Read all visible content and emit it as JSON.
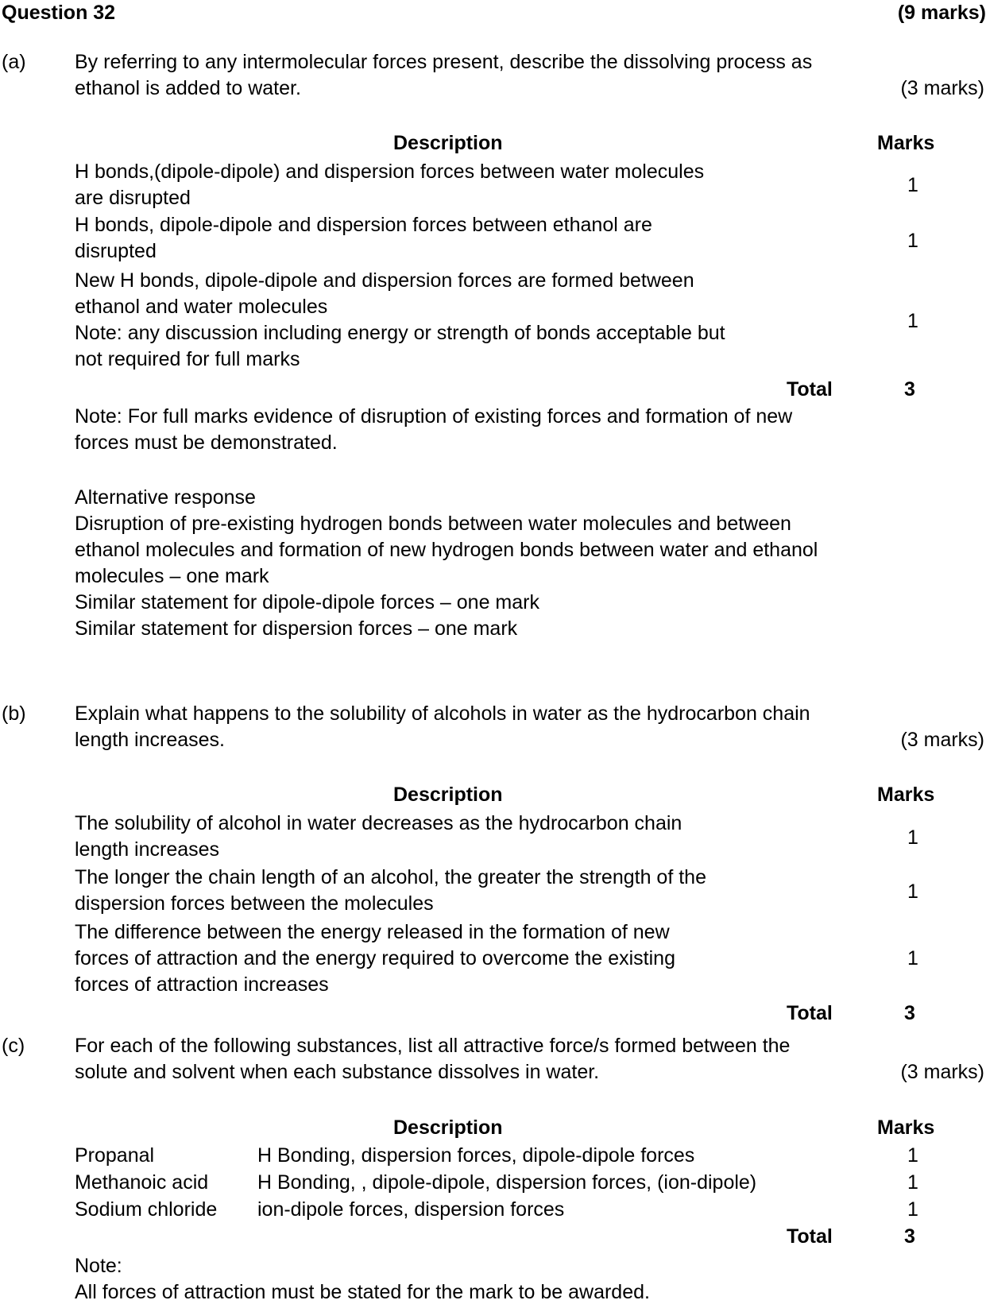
{
  "header": {
    "question": "Question 32",
    "marks": "(9 marks)"
  },
  "part_a": {
    "label": "(a)",
    "question_line1": "By referring to any intermolecular forces present, describe the dissolving process as",
    "question_line2": "ethanol is added to water.",
    "marks": "(3 marks)",
    "table": {
      "header_description": "Description",
      "header_marks": "Marks",
      "rows": [
        {
          "lines": [
            "H bonds,(dipole-dipole) and dispersion forces between water molecules",
            "are disrupted"
          ],
          "mark": "1"
        },
        {
          "lines": [
            "H bonds, dipole-dipole and dispersion forces between ethanol are",
            "disrupted"
          ],
          "mark": "1"
        },
        {
          "lines": [
            "New H bonds, dipole-dipole and dispersion forces are formed between",
            "ethanol and water molecules",
            "Note: any discussion including energy or strength of bonds acceptable but",
            "not required for full marks"
          ],
          "mark": "1"
        }
      ],
      "total_label": "Total",
      "total_value": "3"
    },
    "note_lines": [
      "Note: For full marks evidence of disruption of existing forces and formation of new",
      "forces must be demonstrated."
    ],
    "alternative": [
      "Alternative response",
      "Disruption of pre-existing hydrogen bonds between water molecules and between",
      "ethanol molecules and formation of new hydrogen bonds between water and ethanol",
      "molecules – one mark",
      "Similar statement for dipole-dipole forces – one mark",
      "Similar statement for dispersion forces – one mark"
    ]
  },
  "part_b": {
    "label": "(b)",
    "question_line1": "Explain what happens to the solubility of alcohols in water as the hydrocarbon chain",
    "question_line2": "length increases.",
    "marks": "(3 marks)",
    "table": {
      "header_description": "Description",
      "header_marks": "Marks",
      "rows": [
        {
          "lines": [
            "The solubility of alcohol in water decreases as the hydrocarbon chain",
            "length increases"
          ],
          "mark": "1"
        },
        {
          "lines": [
            "The longer the chain length of an alcohol, the greater the strength of the",
            "dispersion forces between the molecules"
          ],
          "mark": "1"
        },
        {
          "lines": [
            "The difference between the energy released in the formation of new",
            "forces of attraction and the energy required to overcome the existing",
            "forces of attraction increases"
          ],
          "mark": "1"
        }
      ],
      "total_label": "Total",
      "total_value": "3"
    }
  },
  "part_c": {
    "label": "(c)",
    "question_line1": "For each of the following substances, list all attractive force/s formed between the",
    "question_line2": "solute and solvent when each substance dissolves in water.",
    "marks": "(3 marks)",
    "table": {
      "header_description": "Description",
      "header_marks": "Marks",
      "rows": [
        {
          "substance": "Propanal",
          "forces": "H Bonding, dispersion forces, dipole-dipole forces",
          "mark": "1"
        },
        {
          "substance": "Methanoic acid",
          "forces": "H Bonding, , dipole-dipole, dispersion forces, (ion-dipole)",
          "mark": "1"
        },
        {
          "substance": "Sodium chloride",
          "forces": "ion-dipole forces, dispersion forces",
          "mark": "1"
        }
      ],
      "total_label": "Total",
      "total_value": "3"
    },
    "note_lines": [
      "Note:",
      "All forces of attraction must be stated for the mark to be awarded."
    ]
  }
}
